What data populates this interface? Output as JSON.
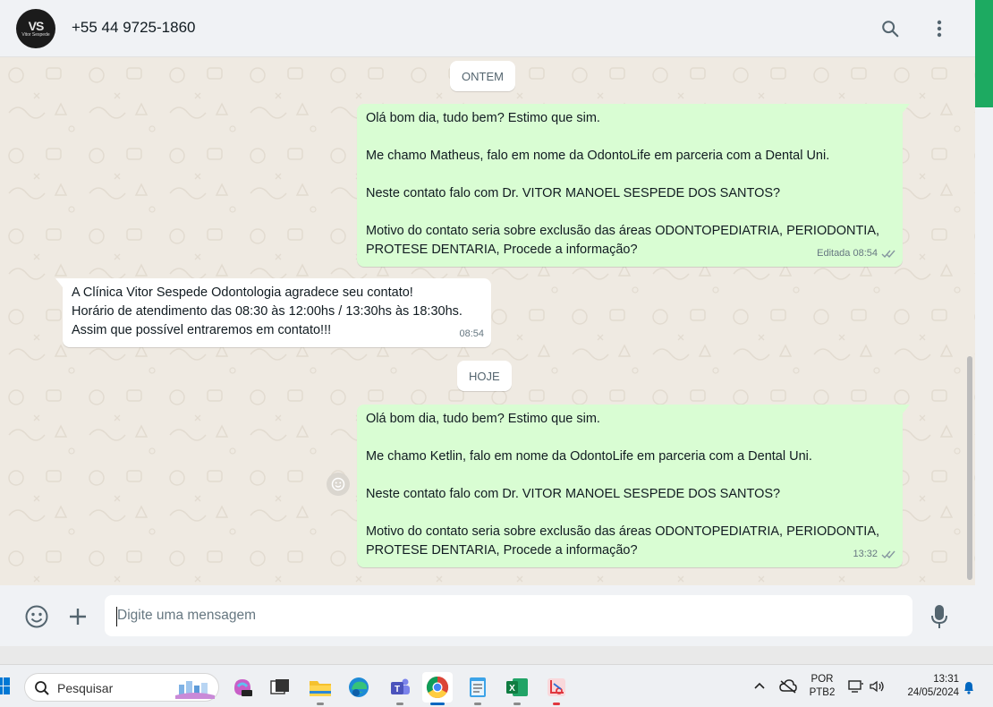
{
  "header": {
    "avatar_logo": "VS",
    "avatar_sub": "Vitor Sespede",
    "contact_name": "+55 44 9725-1860",
    "icons": [
      "search-icon",
      "menu-icon"
    ]
  },
  "chat": {
    "date_yesterday": "ONTEM",
    "date_today": "HOJE",
    "msg1": {
      "line1": "Olá bom dia, tudo bem? Estimo que sim.",
      "line2": "Me chamo Matheus, falo em nome da OdontoLife em parceria com a Dental Uni.",
      "line3": "Neste contato falo com Dr. VITOR MANOEL SESPEDE DOS SANTOS?",
      "line4": "Motivo do contato seria sobre exclusão das áreas ODONTOPEDIATRIA, PERIODONTIA,",
      "line5": "PROTESE DENTARIA, Procede a informação?",
      "meta": "Editada 08:54"
    },
    "msg2": {
      "line1": "A Clínica Vitor Sespede Odontologia agradece seu contato!",
      "line2": "Horário de atendimento das 08:30 às 12:00hs / 13:30hs às 18:30hs.",
      "line3": "Assim que possível entraremos em contato!!!",
      "meta": "08:54"
    },
    "msg3": {
      "line1": "Olá bom dia, tudo bem? Estimo que sim.",
      "line2": "Me chamo Ketlin, falo em nome da OdontoLife em parceria com a Dental Uni.",
      "line3": "Neste contato falo com Dr. VITOR MANOEL SESPEDE DOS SANTOS?",
      "line4": "Motivo do contato seria sobre exclusão das áreas ODONTOPEDIATRIA, PERIODONTIA,",
      "line5": "PROTESE DENTARIA, Procede a informação?",
      "meta": "13:32"
    }
  },
  "composer": {
    "placeholder": "Digite uma mensagem",
    "icons": [
      "emoji-icon",
      "plus-icon",
      "microphone-icon"
    ]
  },
  "taskbar": {
    "search_label": "Pesquisar",
    "lang_top": "POR",
    "lang_bottom": "PTB2",
    "time": "13:31",
    "date": "24/05/2024"
  },
  "colors": {
    "outgoing_bubble": "#d9fdd3",
    "incoming_bubble": "#ffffff",
    "chat_background": "#efeae2",
    "header_background": "#f0f2f5",
    "whatsapp_green": "#1daa61"
  }
}
